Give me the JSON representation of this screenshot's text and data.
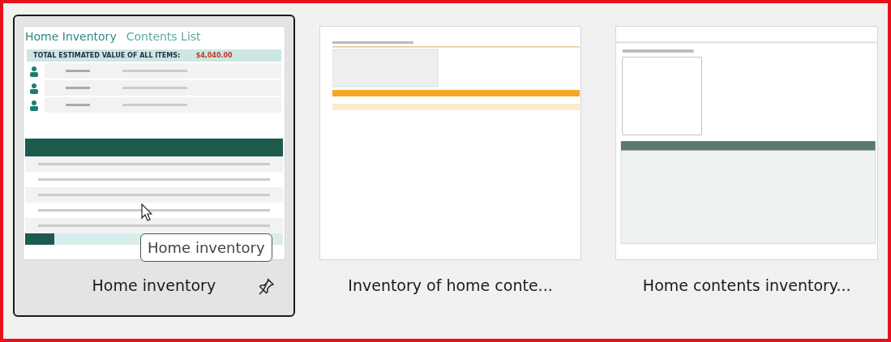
{
  "templates": [
    {
      "title": "Home inventory",
      "selected": true,
      "pinned": true,
      "kind": "home-inventory",
      "preview": {
        "heading": "Home Inventory",
        "subheading": "Contents List",
        "total_label": "TOTAL ESTIMATED VALUE OF ALL ITEMS:",
        "total_value": "$4,040.00"
      }
    },
    {
      "title": "Inventory of home conte...",
      "selected": false,
      "pinned": false,
      "kind": "orange-sheet"
    },
    {
      "title": "Home contents inventory...",
      "selected": false,
      "pinned": false,
      "kind": "green-sheet"
    }
  ],
  "tooltip": {
    "text": "Home inventory"
  }
}
